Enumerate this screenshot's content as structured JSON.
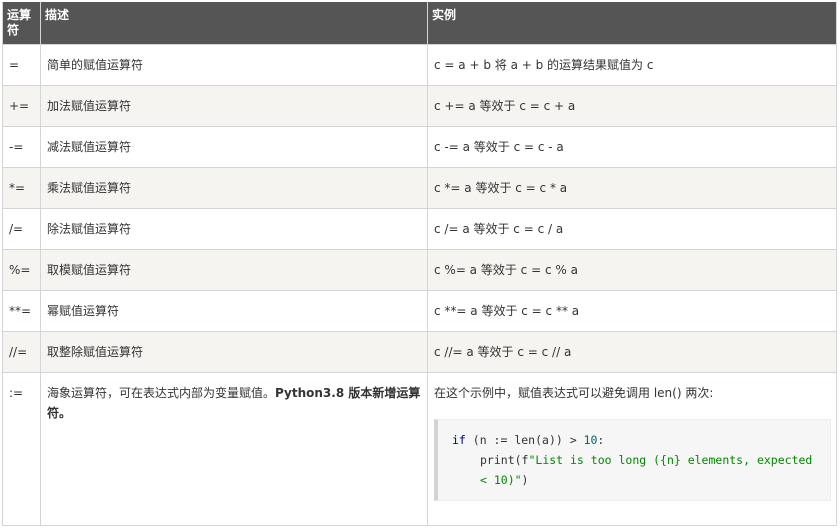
{
  "table": {
    "headers": {
      "operator": "运算符",
      "description": "描述",
      "example": "实例"
    },
    "rows": [
      {
        "operator": "=",
        "description": "简单的赋值运算符",
        "example": "c = a + b 将 a + b 的运算结果赋值为 c"
      },
      {
        "operator": "+=",
        "description": "加法赋值运算符",
        "example": "c += a 等效于 c = c + a"
      },
      {
        "operator": "-=",
        "description": "减法赋值运算符",
        "example": "c -= a 等效于 c = c - a"
      },
      {
        "operator": "*=",
        "description": "乘法赋值运算符",
        "example": "c *= a 等效于 c = c * a"
      },
      {
        "operator": "/=",
        "description": "除法赋值运算符",
        "example": "c /= a 等效于 c = c / a"
      },
      {
        "operator": "%=",
        "description": "取模赋值运算符",
        "example": "c %= a 等效于 c = c % a"
      },
      {
        "operator": "**=",
        "description": "幂赋值运算符",
        "example": "c **= a 等效于 c = c ** a"
      },
      {
        "operator": "//=",
        "description": "取整除赋值运算符",
        "example": "c //= a 等效于 c = c // a"
      }
    ],
    "walrus": {
      "operator": ":=",
      "description_plain": "海象运算符，可在表达式内部为变量赋值。",
      "description_bold": "Python3.8 版本新增运算符。",
      "example_text": "在这个示例中，赋值表达式可以避免调用 len() 两次:",
      "code": {
        "kw_if": "if",
        "cond": " (n := len(a)) > ",
        "num": "10",
        "colon": ":",
        "print_open": "print(f",
        "string": "\"List is too long ({n} elements, expected < 10)\"",
        "close": ")"
      }
    }
  }
}
